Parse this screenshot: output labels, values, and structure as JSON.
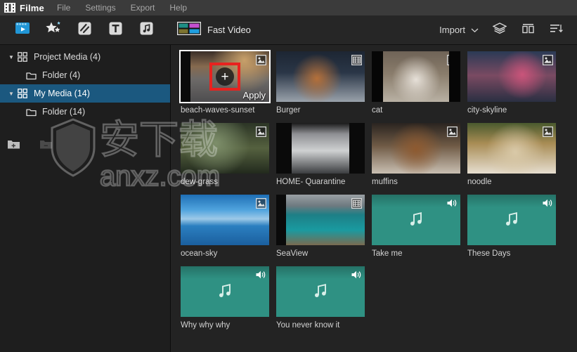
{
  "titlebar": {
    "app_title": "Filme",
    "logo_icon": "film-strip-icon",
    "menu": [
      {
        "label": "File"
      },
      {
        "label": "Settings"
      },
      {
        "label": "Export"
      },
      {
        "label": "Help"
      }
    ]
  },
  "toolbar": {
    "tools": [
      {
        "name": "media-library-icon",
        "title": "Media"
      },
      {
        "name": "effects-icon",
        "title": "Effects"
      },
      {
        "name": "transitions-icon",
        "title": "Transitions"
      },
      {
        "name": "text-icon",
        "title": "Text"
      },
      {
        "name": "audio-icon",
        "title": "Audio"
      }
    ],
    "fast_video_label": "Fast Video",
    "fast_video_icon": "fast-video-icon",
    "fast_video_colors": [
      "#1f8f86",
      "#c44fd0",
      "#7d7430",
      "#1f9fe0"
    ],
    "import_label": "Import",
    "import_chevron_icon": "chevron-down-icon",
    "layers_icon": "layers-icon",
    "grid_icon": "grid-view-icon",
    "sort_icon": "sort-list-icon",
    "accent_color": "#2196d6"
  },
  "sidebar": {
    "items": [
      {
        "label": "Project Media (4)",
        "icon": "grid-squares-icon",
        "caret": "▼",
        "level": 0,
        "selected": false
      },
      {
        "label": "Folder (4)",
        "icon": "folder-icon",
        "caret": "",
        "level": 1,
        "selected": false
      },
      {
        "label": "My Media (14)",
        "icon": "grid-squares-icon",
        "caret": "▼",
        "level": 0,
        "selected": true
      },
      {
        "label": "Folder (14)",
        "icon": "folder-icon",
        "caret": "",
        "level": 1,
        "selected": false
      }
    ],
    "selection_color": "#1b587f",
    "tools": [
      {
        "name": "add-folder-icon",
        "enabled": true
      },
      {
        "name": "remove-folder-icon",
        "enabled": false
      }
    ]
  },
  "media": {
    "selected_index": 0,
    "apply_overlay": {
      "label": "Apply",
      "plus_icon": "plus-icon",
      "highlight_color": "#e8221f"
    },
    "audio_tile_color": "#2f9183",
    "items": [
      {
        "name": "beach-waves-sunset",
        "type": "image",
        "badge": "image-badge-icon",
        "thumb_class": "img-beach",
        "selected": true
      },
      {
        "name": "Burger",
        "type": "video",
        "badge": "video-badge-icon",
        "thumb_class": "img-burger",
        "selected": false
      },
      {
        "name": "cat",
        "type": "image",
        "badge": "image-badge-icon",
        "thumb_class": "img-cat",
        "selected": false
      },
      {
        "name": "city-skyline",
        "type": "image",
        "badge": "image-badge-icon",
        "thumb_class": "img-city",
        "selected": false
      },
      {
        "name": "dew-grass",
        "type": "image",
        "badge": "image-badge-icon",
        "thumb_class": "img-dew",
        "selected": false
      },
      {
        "name": "HOME- Quarantine",
        "type": "video",
        "badge": "video-badge-icon",
        "thumb_class": "img-home",
        "selected": false
      },
      {
        "name": "muffins",
        "type": "image",
        "badge": "image-badge-icon",
        "thumb_class": "img-muffins",
        "selected": false
      },
      {
        "name": "noodle",
        "type": "image",
        "badge": "image-badge-icon",
        "thumb_class": "img-noodle",
        "selected": false
      },
      {
        "name": "ocean-sky",
        "type": "image",
        "badge": "image-badge-icon",
        "thumb_class": "img-ocean",
        "selected": false
      },
      {
        "name": "SeaView",
        "type": "video",
        "badge": "video-badge-icon",
        "thumb_class": "img-sea",
        "selected": false
      },
      {
        "name": "Take me",
        "type": "audio",
        "badge": "speaker-icon",
        "thumb_class": "audio",
        "selected": false
      },
      {
        "name": "These Days",
        "type": "audio",
        "badge": "speaker-icon",
        "thumb_class": "audio",
        "selected": false
      },
      {
        "name": "Why why why",
        "type": "audio",
        "badge": "speaker-icon",
        "thumb_class": "audio",
        "selected": false
      },
      {
        "name": "You never know it",
        "type": "audio",
        "badge": "speaker-icon",
        "thumb_class": "audio",
        "selected": false
      }
    ]
  },
  "watermark": {
    "text": "anxz.com",
    "icon": "shield-icon"
  }
}
